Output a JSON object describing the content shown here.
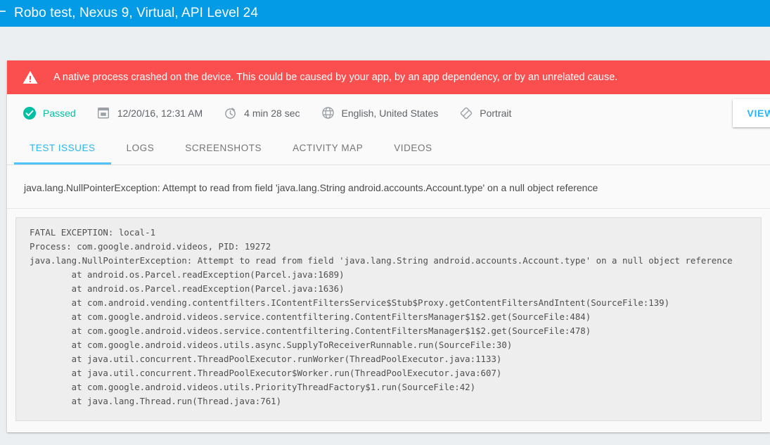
{
  "appbar": {
    "back_icon": "back-arrow-icon",
    "title": "Robo test, Nexus 9, Virtual, API Level 24",
    "background_color": "#039be5"
  },
  "crash_banner": {
    "icon": "warning-triangle-icon",
    "message": "A native process crashed on the device. This could be caused by your app, by an app dependency, or by an unrelated cause.",
    "background_color": "#fb4e4e"
  },
  "meta": {
    "items": [
      {
        "icon": "check-circle-icon",
        "label": "Passed",
        "color": "#00bfa5"
      },
      {
        "icon": "calendar-icon",
        "label": "12/20/16, 12:31 AM"
      },
      {
        "icon": "timer-icon",
        "label": "4 min 28 sec"
      },
      {
        "icon": "globe-icon",
        "label": "English, United States"
      },
      {
        "icon": "screen-rotation-icon",
        "label": "Portrait"
      }
    ],
    "view_button_label": "VIEW"
  },
  "tabs": [
    {
      "label": "TEST ISSUES",
      "active": true
    },
    {
      "label": "LOGS",
      "active": false
    },
    {
      "label": "SCREENSHOTS",
      "active": false
    },
    {
      "label": "ACTIVITY MAP",
      "active": false
    },
    {
      "label": "VIDEOS",
      "active": false
    }
  ],
  "issue": {
    "title": "java.lang.NullPointerException: Attempt to read from field 'java.lang.String android.accounts.Account.type' on a null object reference",
    "stack_trace": "FATAL EXCEPTION: local-1\nProcess: com.google.android.videos, PID: 19272\njava.lang.NullPointerException: Attempt to read from field 'java.lang.String android.accounts.Account.type' on a null object reference\n        at android.os.Parcel.readException(Parcel.java:1689)\n        at android.os.Parcel.readException(Parcel.java:1636)\n        at com.android.vending.contentfilters.IContentFiltersService$Stub$Proxy.getContentFiltersAndIntent(SourceFile:139)\n        at com.google.android.videos.service.contentfiltering.ContentFiltersManager$1$2.get(SourceFile:484)\n        at com.google.android.videos.service.contentfiltering.ContentFiltersManager$1$2.get(SourceFile:478)\n        at com.google.android.videos.utils.async.SupplyToReceiverRunnable.run(SourceFile:30)\n        at java.util.concurrent.ThreadPoolExecutor.runWorker(ThreadPoolExecutor.java:1133)\n        at java.util.concurrent.ThreadPoolExecutor$Worker.run(ThreadPoolExecutor.java:607)\n        at com.google.android.videos.utils.PriorityThreadFactory$1.run(SourceFile:42)\n        at java.lang.Thread.run(Thread.java:761)"
  }
}
